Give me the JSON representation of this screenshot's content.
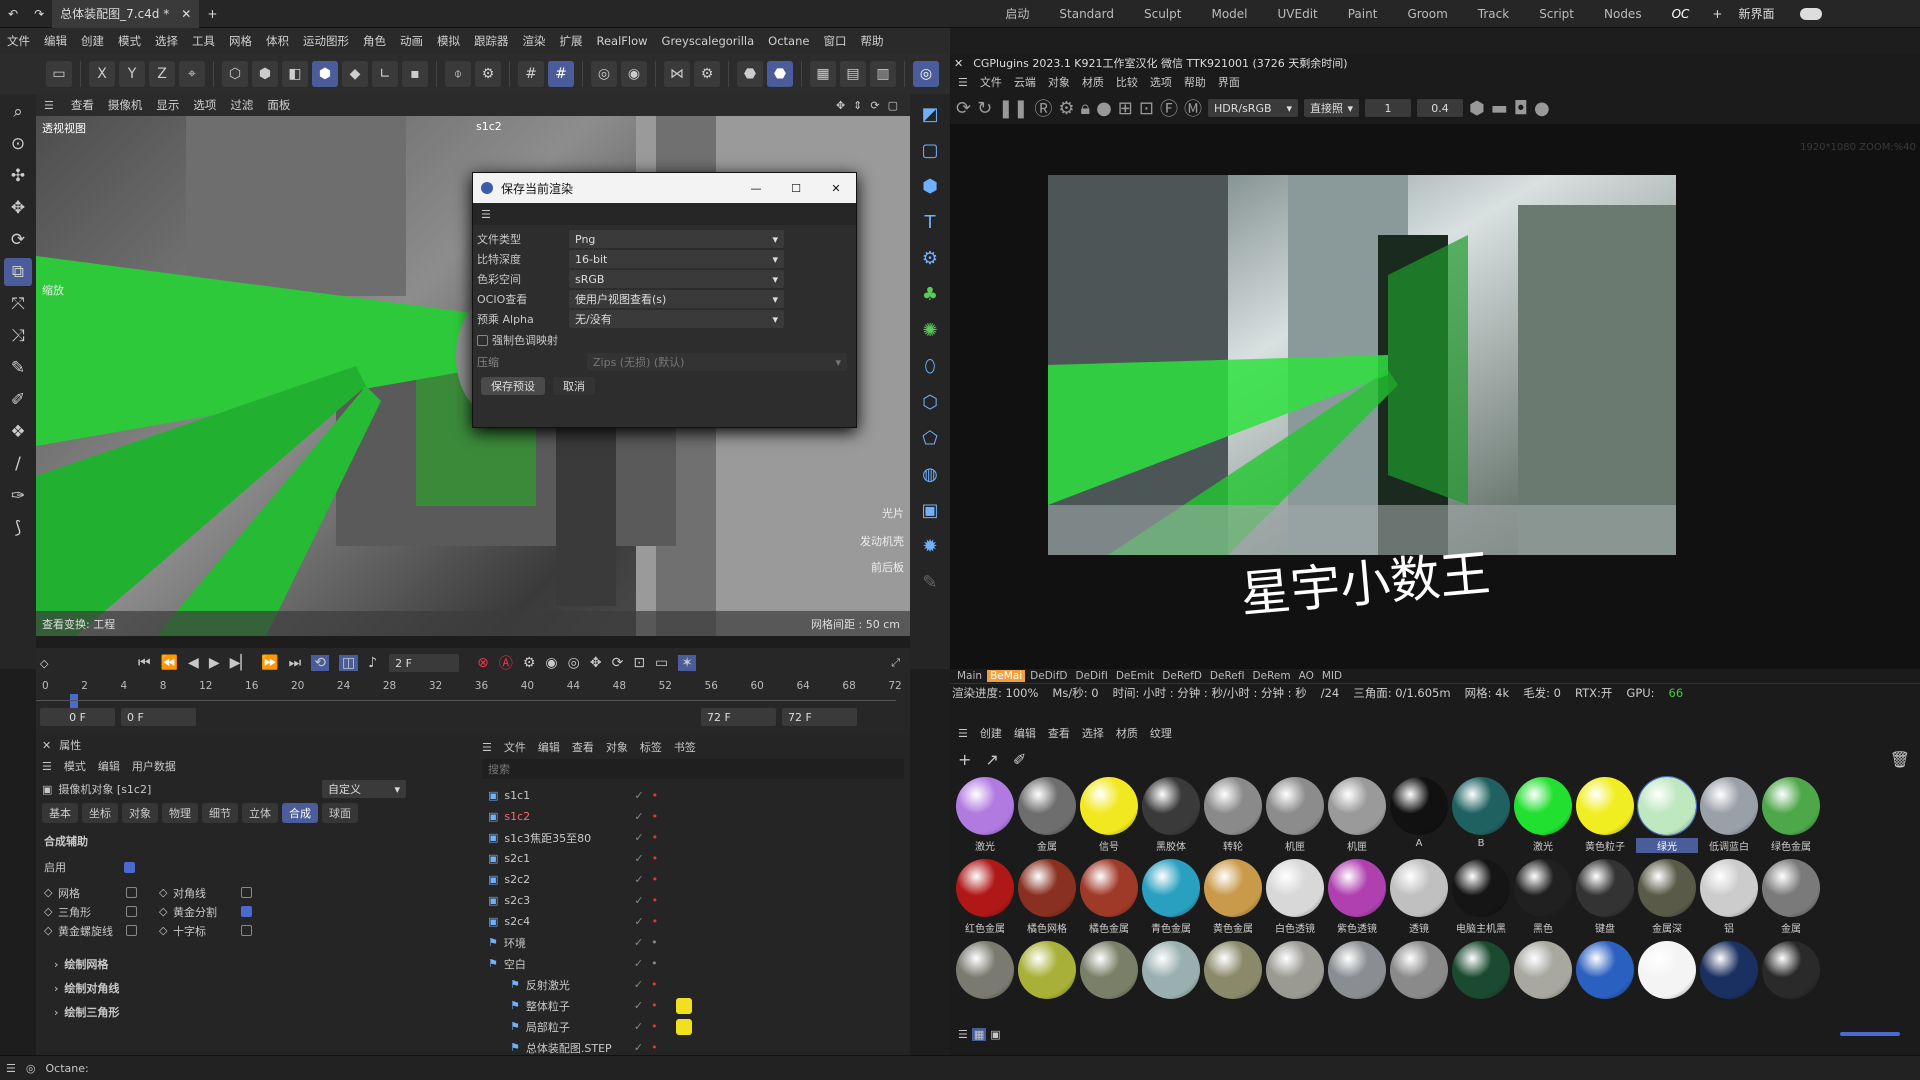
{
  "titlebar": {
    "file_tab": "总体装配图_7.c4d *",
    "layouts": [
      "启动",
      "Standard",
      "Sculpt",
      "Model",
      "UVEdit",
      "Paint",
      "Groom",
      "Track",
      "Script",
      "Nodes",
      "OC"
    ],
    "new_layout": "新界面"
  },
  "menubar": [
    "文件",
    "编辑",
    "创建",
    "模式",
    "选择",
    "工具",
    "网格",
    "体积",
    "运动图形",
    "角色",
    "动画",
    "模拟",
    "跟踪器",
    "渲染",
    "扩展",
    "RealFlow",
    "Greyscalegorilla",
    "Octane",
    "窗口",
    "帮助"
  ],
  "toolbar_axes": [
    "X",
    "Y",
    "Z"
  ],
  "viewport": {
    "menu": [
      "查看",
      "摄像机",
      "显示",
      "选项",
      "过滤",
      "面板"
    ],
    "label": "透视视图",
    "camera": "s1c2",
    "zoom_label": "缩放",
    "bottom_left": "查看变换: 工程",
    "bottom_right": "网格间距 : 50 cm",
    "overlays": [
      "光片",
      "发动机壳",
      "前后板"
    ]
  },
  "dialog": {
    "title": "保存当前渲染",
    "fields": [
      {
        "label": "文件类型",
        "value": "Png"
      },
      {
        "label": "比特深度",
        "value": "16-bit"
      },
      {
        "label": "色彩空间",
        "value": "sRGB"
      },
      {
        "label": "OCIO查看",
        "value": "使用户视图查看(s)"
      },
      {
        "label": "预乘 Alpha",
        "value": "无/没有"
      }
    ],
    "force_tone": "强制色调映射",
    "compress_label": "压缩",
    "compress_value": "Zips (无损) (默认)",
    "save_btn": "保存预设",
    "cancel_btn": "取消"
  },
  "timeline": {
    "frame_field": "2 F",
    "ticks": [
      "0",
      "2",
      "4",
      "8",
      "12",
      "16",
      "20",
      "24",
      "28",
      "32",
      "36",
      "40",
      "44",
      "48",
      "52",
      "56",
      "60",
      "64",
      "68",
      "72"
    ],
    "start": "0 F",
    "start2": "0 F",
    "end": "72 F",
    "end2": "72 F"
  },
  "attr": {
    "title": "属性",
    "menu": [
      "模式",
      "编辑",
      "用户数据"
    ],
    "object": "摄像机对象 [s1c2]",
    "preset": "自定义",
    "tabs": [
      "基本",
      "坐标",
      "对象",
      "物理",
      "细节",
      "立体",
      "合成",
      "球面"
    ],
    "active_tab": "合成",
    "section": "合成辅助",
    "enable": "启用",
    "opts": [
      "网格",
      "对角线",
      "三角形",
      "黄金分割",
      "黄金螺旋线",
      "十字标"
    ],
    "groups": [
      "绘制网格",
      "绘制对角线",
      "绘制三角形"
    ]
  },
  "objmgr": {
    "menu": [
      "文件",
      "编辑",
      "查看",
      "对象",
      "标签",
      "书签"
    ],
    "search_placeholder": "搜索",
    "rows": [
      "s1c1",
      "s1c2",
      "s1c3焦距35至80",
      "s2c1",
      "s2c2",
      "s2c3",
      "s2c4",
      "环境",
      "空白",
      "反射激光",
      "整体粒子",
      "局部粒子",
      "总体装配图.STEP"
    ]
  },
  "octane": {
    "title": "CGPlugins 2023.1  K921工作室汉化  微信  TTK921001 (3726 天剩余时间)",
    "menu": [
      "文件",
      "云端",
      "对象",
      "材质",
      "比较",
      "选项",
      "帮助",
      "界面"
    ],
    "color_mode": "HDR/sRGB",
    "render_mode": "直接照",
    "val1": "1",
    "val2": "0.4",
    "res_label": "1920*1080 ZOOM:%40",
    "passes": [
      "Main",
      "BeMai",
      "DeDifD",
      "DeDifI",
      "DeEmit",
      "DeRefD",
      "DeRefI",
      "DeRem",
      "AO",
      "MID"
    ],
    "stats": {
      "progress": "渲染进度: 100%",
      "ms": "Ms/秒: 0",
      "time": "时间: 小时 : 分钟 : 秒/小时 : 分钟 : 秒",
      "tri": "三角面: 0/1.605m",
      "mesh": "网格: 4k",
      "hair": "毛发: 0",
      "rtx": "RTX:开",
      "gpu": "GPU:",
      "gpu_val": "66",
      "spp": "/24"
    },
    "matmenu": [
      "创建",
      "编辑",
      "查看",
      "选择",
      "材质",
      "纹理"
    ],
    "materials": [
      {
        "name": "激光",
        "color": "#b07ae0"
      },
      {
        "name": "金属",
        "color": "#6e6e6e"
      },
      {
        "name": "信号",
        "color": "#f2e820"
      },
      {
        "name": "黑胶体",
        "color": "#3a3a3a"
      },
      {
        "name": "转轮",
        "color": "#8a8a8a"
      },
      {
        "name": "机匣",
        "color": "#8c8c8c"
      },
      {
        "name": "机匣",
        "color": "#9a9a9a"
      },
      {
        "name": "A",
        "color": "#111111"
      },
      {
        "name": "B",
        "color": "#1f6060"
      },
      {
        "name": "激光",
        "color": "#22e030"
      },
      {
        "name": "黄色粒子",
        "color": "#f0ee20"
      },
      {
        "name": "绿光",
        "color": "#bde8c0"
      },
      {
        "name": "低调蓝白",
        "color": "#9aa0a8"
      },
      {
        "name": "绿色金属",
        "color": "#4ea84a"
      },
      {
        "name": "红色金属",
        "color": "#b01818"
      },
      {
        "name": "橘色网格",
        "color": "#8a3020"
      },
      {
        "name": "橘色金属",
        "color": "#a03a28"
      },
      {
        "name": "青色金属",
        "color": "#2aa0c0"
      },
      {
        "name": "黄色金属",
        "color": "#c89a4a"
      },
      {
        "name": "白色透镜",
        "color": "#d8d8d8"
      },
      {
        "name": "紫色透镜",
        "color": "#b040b0"
      },
      {
        "name": "透镜",
        "color": "#c0c0c0"
      },
      {
        "name": "电脑主机黑",
        "color": "#151515"
      },
      {
        "name": "黑色",
        "color": "#202020"
      },
      {
        "name": "键盘",
        "color": "#333333"
      },
      {
        "name": "金属深",
        "color": "#5a5a48"
      },
      {
        "name": "铝",
        "color": "#cccccc"
      },
      {
        "name": "金属",
        "color": "#7a7a7a"
      },
      {
        "name": "",
        "color": "#7a7a70"
      },
      {
        "name": "",
        "color": "#a8b038"
      },
      {
        "name": "",
        "color": "#7a8068"
      },
      {
        "name": "",
        "color": "#9ab0b0"
      },
      {
        "name": "",
        "color": "#8a8a6a"
      },
      {
        "name": "",
        "color": "#9a9a92"
      },
      {
        "name": "",
        "color": "#8a8e92"
      },
      {
        "name": "",
        "color": "#8a8a8a"
      },
      {
        "name": "",
        "color": "#1a4a30"
      },
      {
        "name": "",
        "color": "#a8a8a0"
      },
      {
        "name": "",
        "color": "#2a60c0"
      },
      {
        "name": "",
        "color": "#f4f4f4"
      },
      {
        "name": "",
        "color": "#1a3060"
      },
      {
        "name": "",
        "color": "#2a2a2a"
      }
    ]
  },
  "status": "Octane:"
}
